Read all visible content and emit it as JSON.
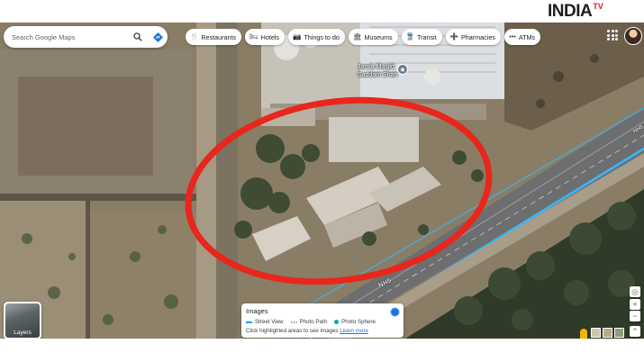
{
  "branding": {
    "logo_text": "INDIA",
    "logo_suffix": "TV"
  },
  "search": {
    "placeholder": "Search Google Maps",
    "icon": "search-icon",
    "directions_icon": "directions-icon"
  },
  "categories": [
    {
      "label": "Restaurants",
      "icon": "restaurant-icon",
      "glyph": "🍴"
    },
    {
      "label": "Hotels",
      "icon": "hotel-icon",
      "glyph": "🛏"
    },
    {
      "label": "Things to do",
      "icon": "camera-icon",
      "glyph": "📷"
    },
    {
      "label": "Museums",
      "icon": "museum-icon",
      "glyph": "🏛"
    },
    {
      "label": "Transit",
      "icon": "transit-icon",
      "glyph": "🚆"
    },
    {
      "label": "Pharmacies",
      "icon": "pharmacy-icon",
      "glyph": "➕"
    },
    {
      "label": "ATMs",
      "icon": "atm-icon",
      "glyph": "•••"
    }
  ],
  "map": {
    "place_label_line1": "Jamia Masjid",
    "place_label_line2": "Saddam Shah",
    "road_label": "NH5",
    "road_label_small": "NH5",
    "highlight_color": "#e8261c"
  },
  "layers": {
    "label": "Layers"
  },
  "images_panel": {
    "title": "Images",
    "legend": [
      {
        "label": "Street View",
        "color": "#1aa3e8",
        "kind": "line"
      },
      {
        "label": "Photo Path",
        "color": "#9aa0a6",
        "kind": "dash"
      },
      {
        "label": "Photo Sphere",
        "color": "#12a4b8",
        "kind": "dot"
      }
    ],
    "hint_text": "Click highlighted areas to see images",
    "learn_more": "Learn more"
  },
  "controls": {
    "locate_icon": "my-location-icon",
    "zoom_in": "+",
    "zoom_out": "−",
    "expand": "⌃"
  }
}
